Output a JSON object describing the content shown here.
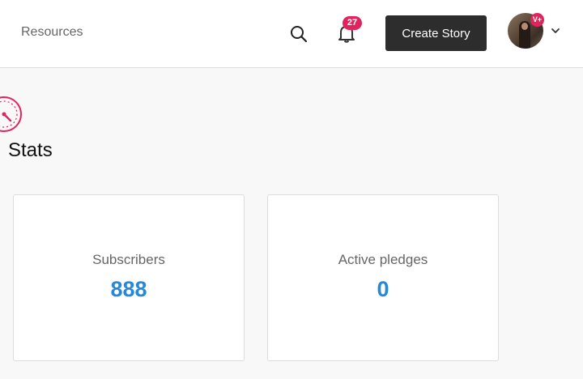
{
  "header": {
    "resources_label": "Resources",
    "notification_count": "27",
    "create_story_label": "Create Story",
    "avatar_badge": "V+",
    "icons": {
      "search": "search-icon",
      "notifications": "bell-icon",
      "account_menu": "chevron-down-icon"
    }
  },
  "stats": {
    "title": "Stats",
    "icon": "speedometer-icon",
    "cards": [
      {
        "label": "Subscribers",
        "value": "888"
      },
      {
        "label": "Active pledges",
        "value": "0"
      }
    ]
  },
  "colors": {
    "accent": "#2688d8",
    "brand_pink": "#e0245e",
    "button_dark": "#2d2d2d"
  }
}
